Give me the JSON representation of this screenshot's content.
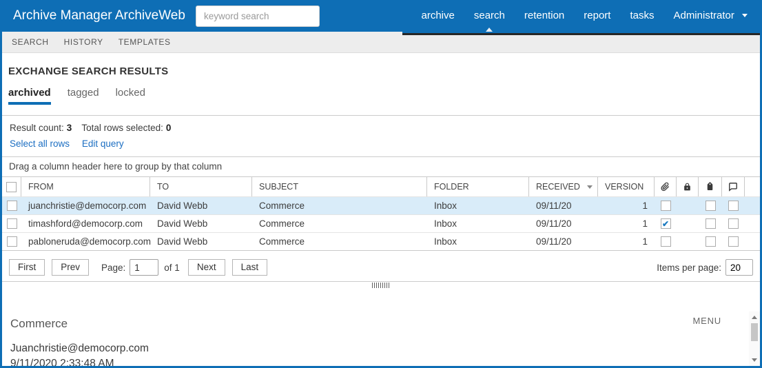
{
  "colors": {
    "accent_blue": "#0e6eb5",
    "row_highlight": "#d9ecf9",
    "link_blue": "#1b6ec2",
    "nav_underline_dark": "#262626"
  },
  "header": {
    "brand": "Archive Manager ArchiveWeb",
    "search_placeholder": "keyword search",
    "nav": [
      {
        "label": "archive",
        "active": false
      },
      {
        "label": "search",
        "active": true
      },
      {
        "label": "retention",
        "active": false
      },
      {
        "label": "report",
        "active": false
      },
      {
        "label": "tasks",
        "active": false
      }
    ],
    "user_menu": "Administrator"
  },
  "subnav": {
    "items": [
      "SEARCH",
      "HISTORY",
      "TEMPLATES"
    ]
  },
  "results": {
    "title": "EXCHANGE SEARCH RESULTS",
    "tabs": [
      {
        "label": "archived",
        "active": true
      },
      {
        "label": "tagged",
        "active": false
      },
      {
        "label": "locked",
        "active": false
      }
    ],
    "result_count_label": "Result count:",
    "result_count": "3",
    "selected_label": "Total rows selected:",
    "selected_count": "0",
    "links": {
      "select_all": "Select all rows",
      "edit_query": "Edit query"
    },
    "group_hint": "Drag a column header here to group by that column"
  },
  "table": {
    "columns": [
      "FROM",
      "TO",
      "SUBJECT",
      "FOLDER",
      "RECEIVED",
      "VERSION"
    ],
    "icon_columns": [
      "attachment-icon",
      "lock-icon",
      "tag-icon",
      "comment-icon"
    ],
    "rows": [
      {
        "from": "juanchristie@democorp.com",
        "to": "David Webb",
        "subject": "Commerce",
        "folder": "Inbox",
        "received": "09/11/20",
        "version": "1",
        "selected": false,
        "attachment": false,
        "tagged": false,
        "commented": false,
        "highlighted": true
      },
      {
        "from": "timashford@democorp.com",
        "to": "David Webb",
        "subject": "Commerce",
        "folder": "Inbox",
        "received": "09/11/20",
        "version": "1",
        "selected": false,
        "attachment": true,
        "tagged": false,
        "commented": false,
        "highlighted": false
      },
      {
        "from": "pabloneruda@democorp.com",
        "to": "David Webb",
        "subject": "Commerce",
        "folder": "Inbox",
        "received": "09/11/20",
        "version": "1",
        "selected": false,
        "attachment": false,
        "tagged": false,
        "commented": false,
        "highlighted": false
      }
    ]
  },
  "pagination": {
    "first": "First",
    "prev": "Prev",
    "page_label": "Page:",
    "page_value": "1",
    "of_label": "of 1",
    "next": "Next",
    "last": "Last",
    "items_per_page_label": "Items per page:",
    "items_per_page_value": "20"
  },
  "preview": {
    "subject": "Commerce",
    "menu_label": "MENU",
    "sender": "Juanchristie@democorp.com",
    "datetime": "9/11/2020 2:33:48 AM"
  }
}
